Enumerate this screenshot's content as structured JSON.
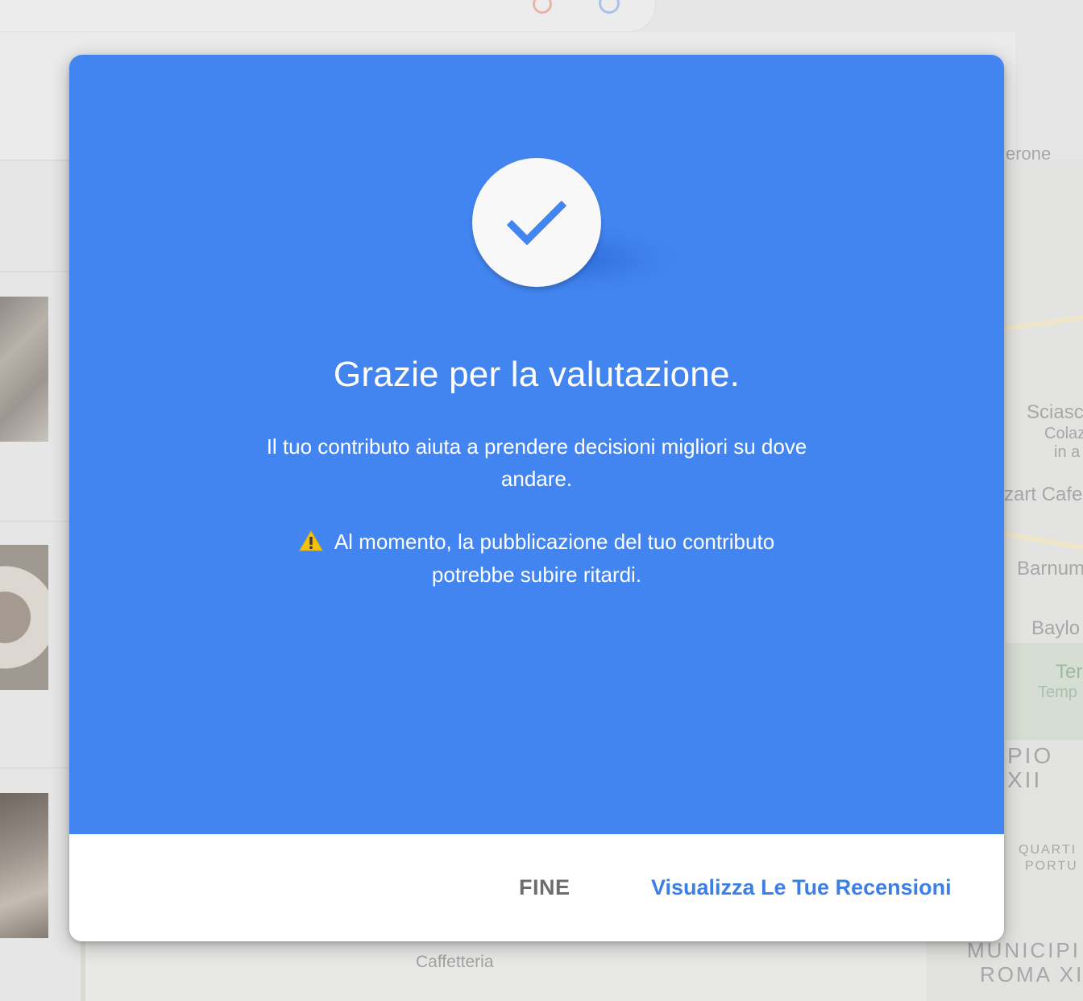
{
  "background": {
    "map_labels": [
      "erone",
      "Sciasc",
      "Colaz",
      "in a",
      "zart Cafe",
      "Barnum",
      "Baylo",
      "Ter",
      "Temp",
      "PIO",
      "XII",
      "QUARTI",
      "PORTU",
      "MUNICIPI",
      "ROMA XI"
    ],
    "bottom_label": "Caffetteria"
  },
  "dialog": {
    "icon": "check-icon",
    "title": "Grazie per la valutazione.",
    "subtitle": "Il tuo contributo aiuta a prendere decisioni migliori su dove andare.",
    "warning_icon": "warning-icon",
    "warning": "Al momento, la pubblicazione del tuo contributo potrebbe subire ritardi.",
    "buttons": {
      "done": "FINE",
      "view_reviews": "Visualizza Le Tue Recensioni"
    }
  },
  "colors": {
    "hero": "#4285f0",
    "link": "#3c7fe6",
    "warning": "#f4c20d"
  }
}
